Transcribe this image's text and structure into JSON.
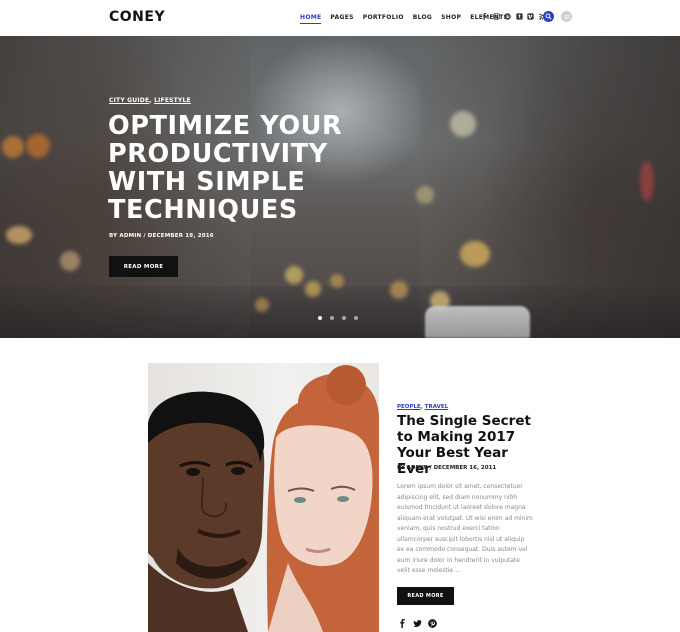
{
  "header": {
    "logo": "CONEY",
    "nav": [
      {
        "label": "HOME",
        "active": true
      },
      {
        "label": "PAGES",
        "active": false
      },
      {
        "label": "PORTFOLIO",
        "active": false
      },
      {
        "label": "BLOG",
        "active": false
      },
      {
        "label": "SHOP",
        "active": false
      },
      {
        "label": "ELEMENTS",
        "active": false
      }
    ],
    "social_icons": [
      "facebook-icon",
      "instagram-icon",
      "pinterest-icon",
      "tumblr-icon",
      "vimeo-icon",
      "rss-icon"
    ],
    "search_icon": "search-icon",
    "menu_icon": "menu-icon",
    "accent_color": "#2c3fbf"
  },
  "hero": {
    "categories": [
      "CITY GUIDE",
      "LIFESTYLE"
    ],
    "category_separator": ", ",
    "title": "OPTIMIZE YOUR PRODUCTIVITY WITH SIMPLE TECHNIQUES",
    "meta": "BY ADMIN / DECEMBER 19, 2016",
    "button_label": "READ MORE",
    "slide_count": 4,
    "active_slide": 1
  },
  "post": {
    "categories": [
      "PEOPLE",
      "TRAVEL"
    ],
    "category_separator": ", ",
    "title": "The Single Secret to Making 2017 Your Best Year Ever",
    "meta": "BY ADMIN / DECEMBER 16, 2011",
    "excerpt": "Lorem ipsum dolor sit amet, consectetuer adipiscing elit, sed diam nonummy nibh euismod tincidunt ut laoreet dolore magna aliquam erat volutpat. Ut wisi enim ad minim veniam, quis nostrud exerci tation ullamcorper suscipit lobortis nisl ut aliquip ex ea commodo consequat. Duis autem vel eum iriure dolor in hendrerit in vulputate velit esse molestie ...",
    "button_label": "READ MORE",
    "share_icons": [
      "facebook-icon",
      "twitter-icon",
      "pinterest-icon"
    ]
  }
}
